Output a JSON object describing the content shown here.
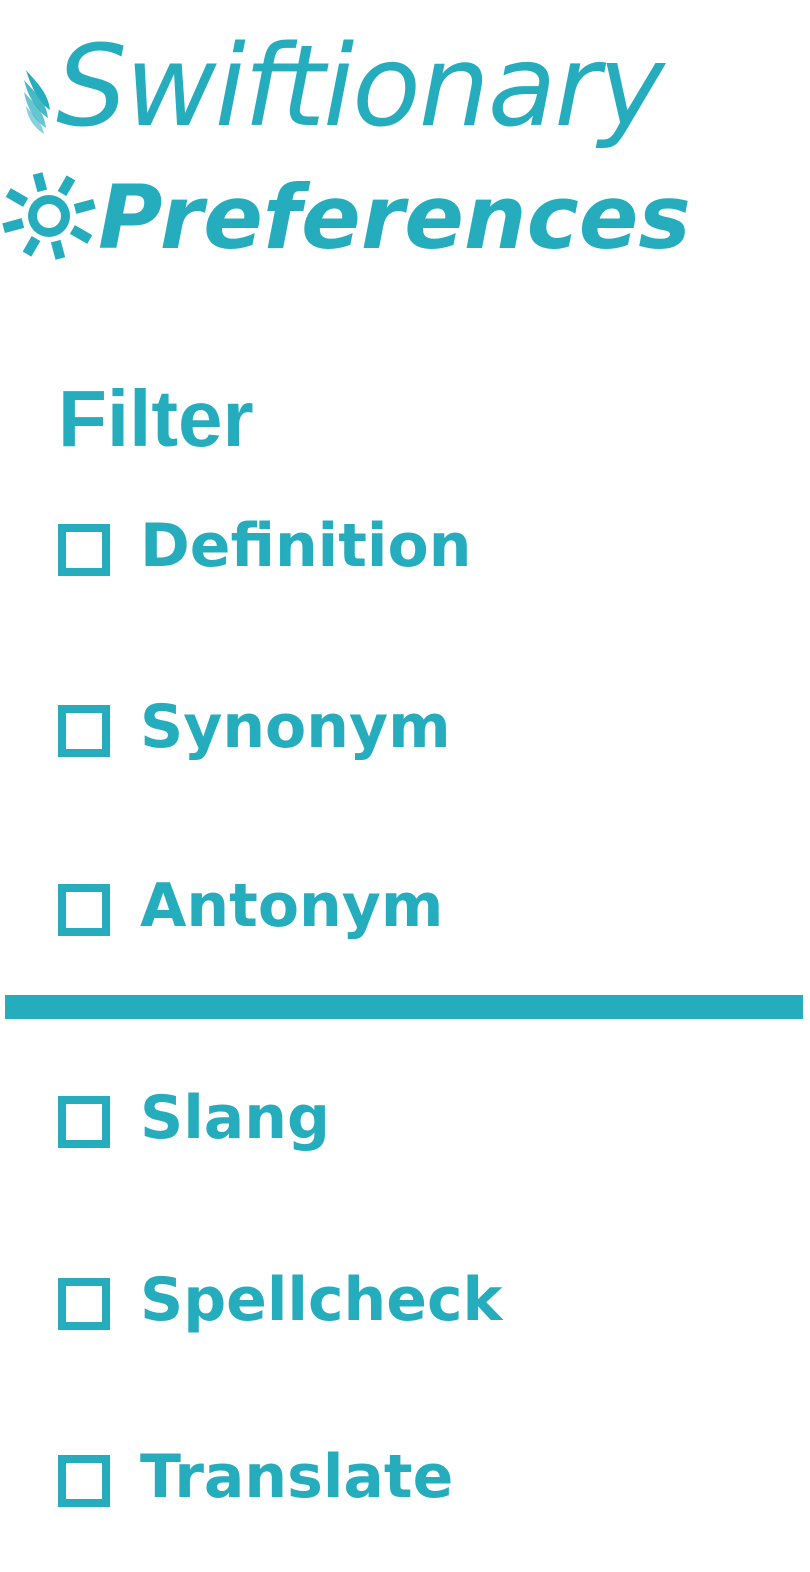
{
  "app": {
    "name": "Swiftionary",
    "screen_title": "Preferences"
  },
  "filter": {
    "heading": "Filter",
    "primary_options": [
      {
        "label": "Definition",
        "checked": false
      },
      {
        "label": "Synonym",
        "checked": false
      },
      {
        "label": "Antonym",
        "checked": false
      }
    ],
    "secondary_options": [
      {
        "label": "Slang",
        "checked": false
      },
      {
        "label": "Spellcheck",
        "checked": false
      },
      {
        "label": "Translate",
        "checked": false
      }
    ]
  },
  "colors": {
    "accent": "#26adbd",
    "background": "#ffffff"
  },
  "icons": {
    "logo": "feather-icon",
    "preferences": "gear-icon",
    "checkbox": "checkbox-unchecked-icon"
  }
}
